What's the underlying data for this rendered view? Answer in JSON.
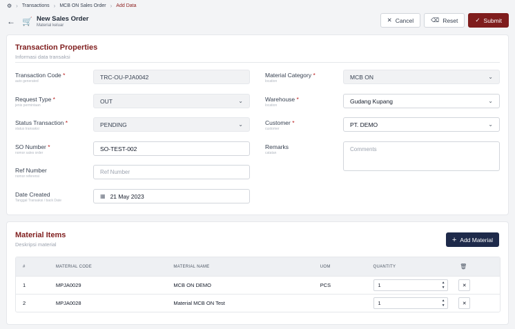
{
  "breadcrumb": {
    "items": [
      "Transactions",
      "MCB ON Sales Order",
      "Add Data"
    ]
  },
  "header": {
    "title": "New Sales Order",
    "subtitle": "Material keluar"
  },
  "actions": {
    "cancel": "Cancel",
    "reset": "Reset",
    "submit": "Submit"
  },
  "props": {
    "title": "Transaction Properties",
    "subtitle": "Informasi data transaksi",
    "left": [
      {
        "label": "Transaction Code",
        "required": "*",
        "hint": "auto generated",
        "value": "TRC-OU-PJA0042"
      },
      {
        "label": "Request Type",
        "required": "*",
        "hint": "jenis permintaan",
        "value": "OUT"
      },
      {
        "label": "Status Transaction",
        "required": "*",
        "hint": "status transaksi",
        "value": "PENDING"
      },
      {
        "label": "SO Number",
        "required": "*",
        "hint": "nomor sales order",
        "value": "SO-TEST-002"
      },
      {
        "label": "Ref Number",
        "required": "",
        "hint": "nomor referensi",
        "placeholder": "Ref Number"
      },
      {
        "label": "Date Created",
        "required": "",
        "hint": "Tanggal Transaksi / back Date",
        "value": "21 May 2023"
      }
    ],
    "right": [
      {
        "label": "Material Category",
        "required": "*",
        "hint": "location",
        "value": "MCB ON"
      },
      {
        "label": "Warehouse",
        "required": "*",
        "hint": "location",
        "value": "Gudang Kupang"
      },
      {
        "label": "Customer",
        "required": "*",
        "hint": "customer",
        "value": "PT. DEMO"
      },
      {
        "label": "Remarks",
        "required": "",
        "hint": "catatan",
        "placeholder": "Comments"
      }
    ]
  },
  "materials": {
    "title": "Material Items",
    "subtitle": "Deskripsi material",
    "add_label": "Add Material",
    "columns": [
      "#",
      "MATERIAL CODE",
      "MATERIAL NAME",
      "UOM",
      "QUANTITY"
    ],
    "rows": [
      {
        "no": "1",
        "code": "MPJA0029",
        "name": "MCB ON DEMO",
        "uom": "PCS",
        "qty": "1"
      },
      {
        "no": "2",
        "code": "MPJA0028",
        "name": "Material MCB ON Test",
        "uom": "",
        "qty": "1"
      }
    ]
  }
}
